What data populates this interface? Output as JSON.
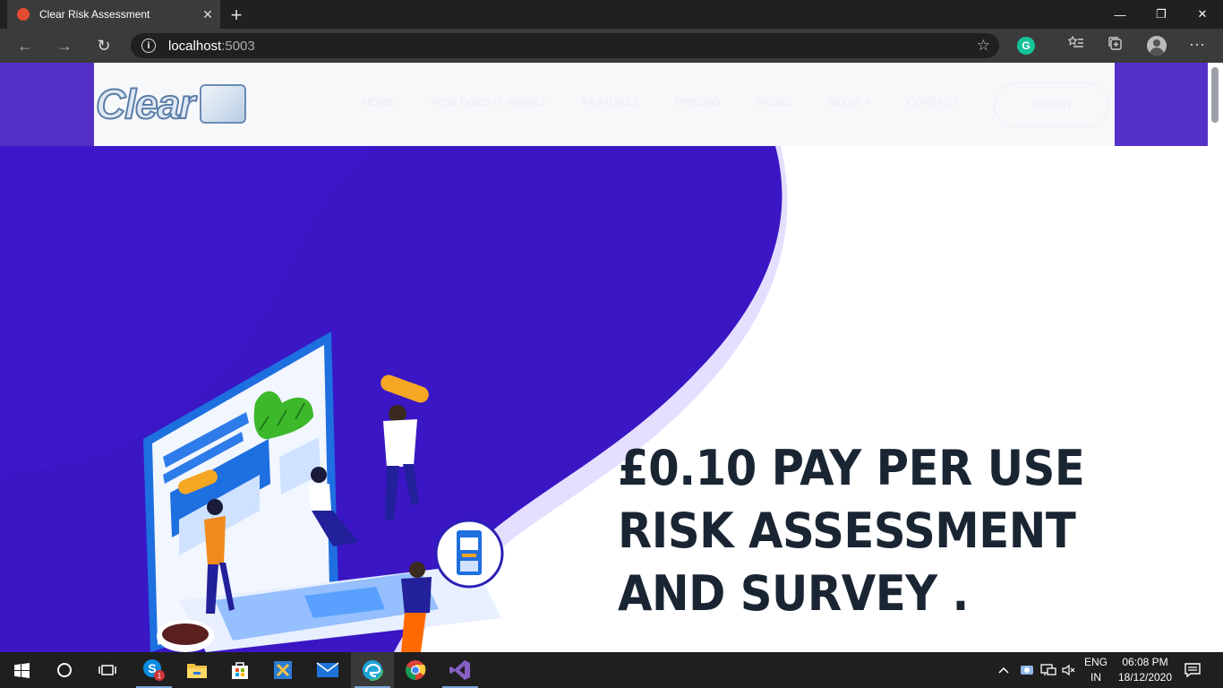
{
  "browser": {
    "tab_title": "Clear Risk Assessment",
    "tab_close": "✕",
    "new_tab": "+",
    "url_host": "localhost",
    "url_port": ":5003",
    "back_icon": "←",
    "forward_icon": "→",
    "reload_icon": "↻",
    "star_icon": "☆",
    "grammarly_label": "G",
    "window": {
      "minimize": "—",
      "restore": "❐",
      "close": "✕"
    }
  },
  "site": {
    "logo_text": "Clear",
    "nav": [
      "HOME",
      "HOW DOES IT WORKZ",
      "FEATURES",
      "PRICING",
      "PAGES",
      "BLOG",
      "CONTACT"
    ],
    "sign_in": "SIGN IN",
    "headline": [
      "£0.10 PAY PER USE",
      "RISK ASSESSMENT",
      "AND SURVEY ."
    ],
    "colors": {
      "hero_purple": "#3a16c4",
      "hero_light": "#e4deff",
      "headline": "#1a2533"
    }
  },
  "taskbar": {
    "apps": [
      "start-icon",
      "search-icon",
      "task-view-icon",
      "skype-icon",
      "file-explorer-icon",
      "store-icon",
      "vs-tool-icon",
      "mail-icon",
      "edge-icon",
      "chrome-icon",
      "visual-studio-icon"
    ],
    "skype_badge": "1",
    "lang_line1": "ENG",
    "lang_line2": "IN",
    "time": "06:08 PM",
    "date": "18/12/2020"
  }
}
